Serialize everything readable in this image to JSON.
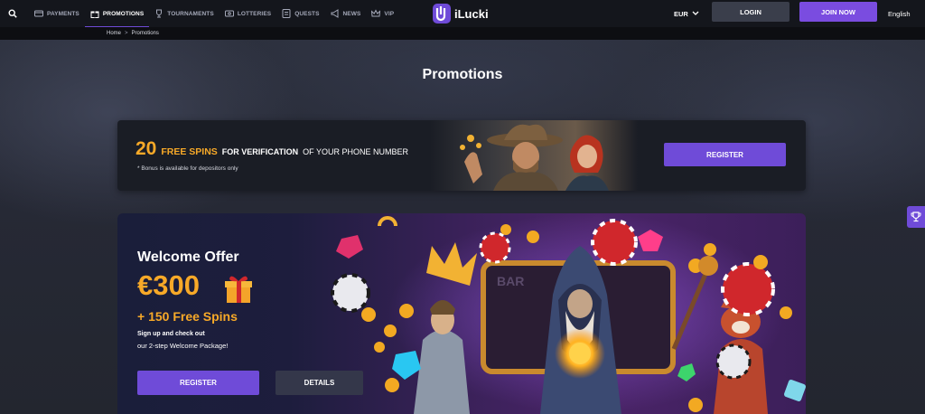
{
  "nav": {
    "items": [
      {
        "label": "PAYMENTS",
        "icon": "payments-icon",
        "active": false
      },
      {
        "label": "PROMOTIONS",
        "icon": "gift-icon",
        "active": true
      },
      {
        "label": "TOURNAMENTS",
        "icon": "trophy-icon",
        "active": false
      },
      {
        "label": "LOTTERIES",
        "icon": "lottery-icon",
        "active": false
      },
      {
        "label": "QUESTS",
        "icon": "quests-icon",
        "active": false
      },
      {
        "label": "NEWS",
        "icon": "megaphone-icon",
        "active": false
      },
      {
        "label": "VIP",
        "icon": "crown-icon",
        "active": false
      }
    ]
  },
  "brand": {
    "name": "iLucki"
  },
  "header": {
    "currency": "EUR",
    "login_label": "LOGIN",
    "join_label": "JOIN NOW",
    "language": "English"
  },
  "breadcrumb": {
    "home": "Home",
    "separator": ">",
    "current": "Promotions"
  },
  "page": {
    "title": "Promotions"
  },
  "promo_phone": {
    "amount": "20",
    "spins": "FREE SPINS",
    "for_verification": "FOR VERIFICATION",
    "rest": "OF YOUR PHONE NUMBER",
    "note": "* Bonus is available for depositors only",
    "button_label": "REGISTER"
  },
  "promo_welcome": {
    "title": "Welcome Offer",
    "amount": "€300",
    "spins": "+ 150 Free Spins",
    "line1": "Sign up and check out",
    "line2": "our 2-step Welcome Package!",
    "register_label": "REGISTER",
    "details_label": "DETAILS"
  },
  "colors": {
    "accent": "#6f4bd8",
    "highlight": "#f7a928",
    "topbar": "#14161c",
    "panel": "#1a1d25"
  }
}
